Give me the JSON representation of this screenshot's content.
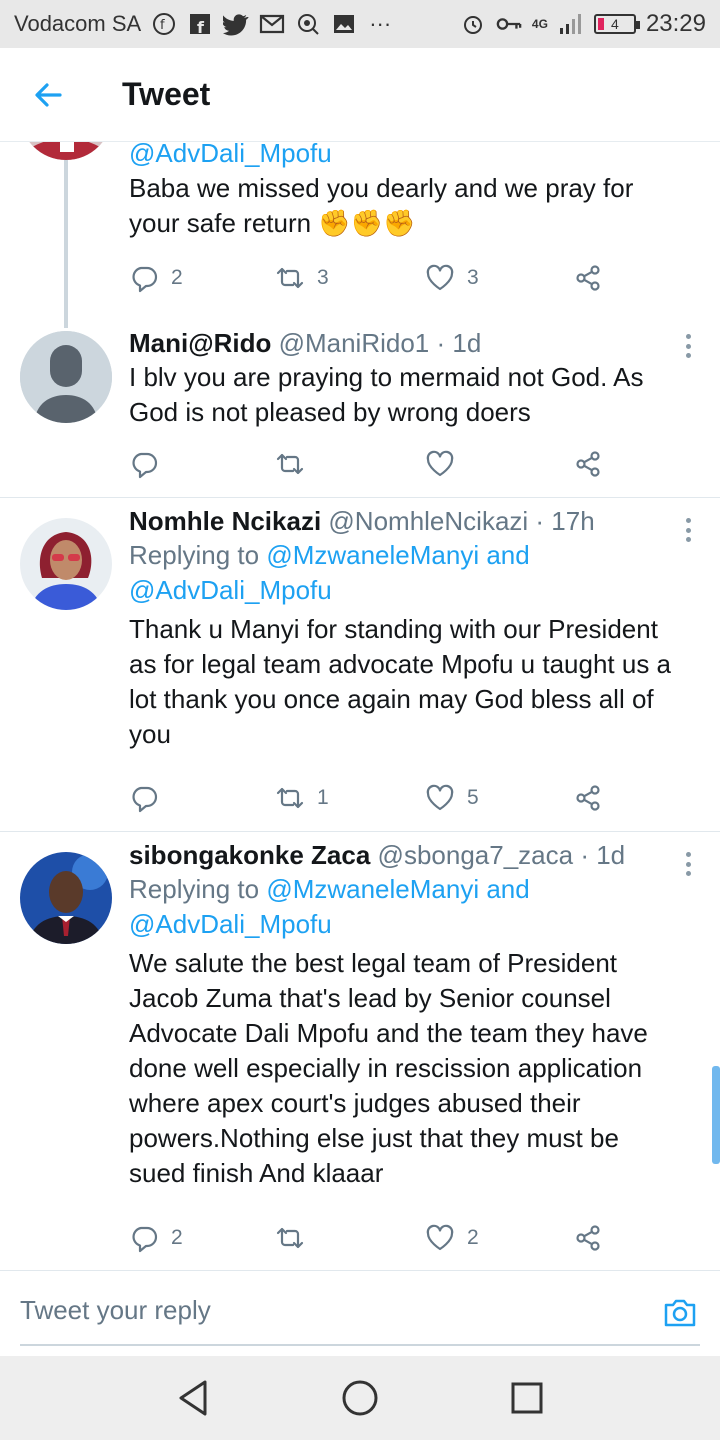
{
  "status_bar": {
    "carrier": "Vodacom SA",
    "network": "4G",
    "battery": "4",
    "time": "23:29"
  },
  "header": {
    "title": "Tweet"
  },
  "tweets": [
    {
      "mention": "@AdvDali_Mpofu",
      "text_lines": [
        "Baba we missed you dearly and we pray for",
        "your safe return ✊✊✊"
      ],
      "replies": "2",
      "retweets": "3",
      "likes": "3"
    },
    {
      "name": "Mani@Rido",
      "handle": "@ManiRido1",
      "time": "1d",
      "text_lines": [
        "I blv you are praying to mermaid not God. As",
        "God is not pleased by wrong doers"
      ],
      "replies": "",
      "retweets": "",
      "likes": ""
    },
    {
      "name": "Nomhle Ncikazi",
      "handle": "@NomhleNcikazi",
      "time": "17h",
      "replying_prefix": "Replying to",
      "replying_to": "@MzwaneleManyi and",
      "replying_to2": "@AdvDali_Mpofu",
      "text_lines": [
        "Thank u Manyi for standing with our President",
        "as for legal team advocate Mpofu u taught us a",
        "lot thank you once again may God bless all of",
        "you"
      ],
      "replies": "",
      "retweets": "1",
      "likes": "5"
    },
    {
      "name": "sibongakonke Zaca",
      "handle": "@sbonga7_zaca",
      "time": "1d",
      "replying_prefix": "Replying to",
      "replying_to": "@MzwaneleManyi and",
      "replying_to2": "@AdvDali_Mpofu",
      "text_lines": [
        "We salute the best legal team of President",
        "Jacob Zuma  that's lead by Senior counsel",
        "Advocate Dali Mpofu and the team they have",
        "done well especially in rescission application",
        "where apex court's judges abused their",
        "powers.Nothing else just that they must be",
        "sued finish And klaaar"
      ],
      "replies": "2",
      "retweets": "",
      "likes": "2"
    }
  ],
  "reply_bar": {
    "placeholder": "Tweet your reply"
  },
  "icons": {
    "back": "arrow-left-icon",
    "reply": "reply-icon",
    "retweet": "retweet-icon",
    "like": "heart-icon",
    "share": "share-icon",
    "more": "more-vertical-icon",
    "camera": "camera-icon"
  },
  "colors": {
    "accent": "#1da1f2",
    "muted": "#657786",
    "text": "#14171a"
  }
}
